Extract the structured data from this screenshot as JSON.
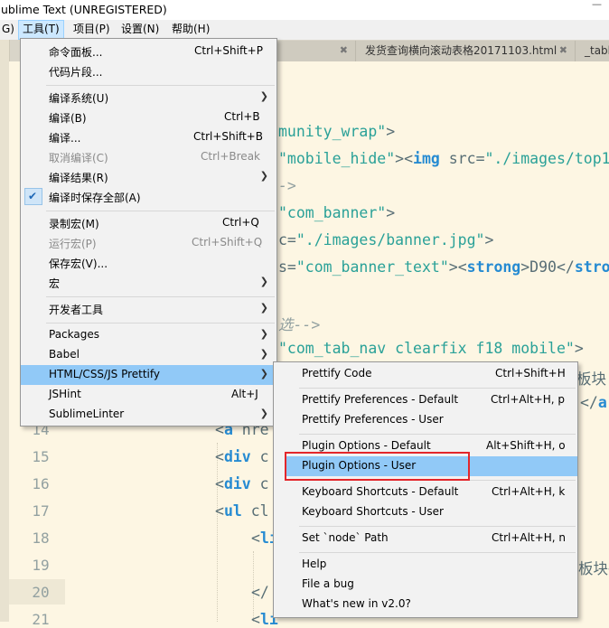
{
  "window": {
    "title": "ublime Text (UNREGISTERED)"
  },
  "menubar": [
    {
      "label": "G)",
      "active": false
    },
    {
      "label": "工具(T)",
      "active": true
    },
    {
      "label": "项目(P)",
      "active": false
    },
    {
      "label": "设置(N)",
      "active": false
    },
    {
      "label": "帮助(H)",
      "active": false
    }
  ],
  "tabs": [
    {
      "label": "",
      "close": "✖"
    },
    {
      "label": "发货查询横向滚动表格20171103.html",
      "close": "✖"
    },
    {
      "label": "_table",
      "close": ""
    }
  ],
  "gutter": {
    "lines": [
      "14",
      "15",
      "16",
      "17",
      "18",
      "19",
      "20",
      "21"
    ],
    "current_line": "20"
  },
  "code_lines": [
    {
      "tokens": [
        {
          "c": "str",
          "t": "munity_wrap\""
        },
        {
          "c": "pl",
          "t": ">"
        }
      ]
    },
    {
      "tokens": [
        {
          "c": "str",
          "t": "\"mobile_hide\""
        },
        {
          "c": "pl",
          "t": "><"
        },
        {
          "c": "tag",
          "t": "img"
        },
        {
          "c": "pl",
          "t": " src="
        },
        {
          "c": "str",
          "t": "\"./images/top1"
        }
      ]
    },
    {
      "tokens": [
        {
          "c": "cm",
          "t": "->"
        }
      ]
    },
    {
      "tokens": [
        {
          "c": "str",
          "t": "\"com_banner\""
        },
        {
          "c": "pl",
          "t": ">"
        }
      ]
    },
    {
      "tokens": [
        {
          "c": "pl",
          "t": "c="
        },
        {
          "c": "str",
          "t": "\"./images/banner.jpg\""
        },
        {
          "c": "pl",
          "t": ">"
        }
      ]
    },
    {
      "tokens": [
        {
          "c": "pl",
          "t": "s="
        },
        {
          "c": "str",
          "t": "\"com_banner_text\""
        },
        {
          "c": "pl",
          "t": "><"
        },
        {
          "c": "tag",
          "t": "strong"
        },
        {
          "c": "pl",
          "t": ">D90</"
        },
        {
          "c": "tag",
          "t": "stro"
        }
      ]
    },
    {
      "tokens": []
    },
    {
      "tokens": [
        {
          "c": "cm",
          "t": "选-->"
        }
      ]
    },
    {
      "tokens": [
        {
          "c": "str",
          "t": "\"com_tab_nav clearfix f18 mobile\""
        },
        {
          "c": "pl",
          "t": ">"
        }
      ]
    },
    {
      "tokens": [
        {
          "c": "pl",
          "t": "板块"
        }
      ]
    },
    {
      "tokens": [
        {
          "c": "pl",
          "t": "</"
        },
        {
          "c": "tag",
          "t": "a"
        }
      ]
    },
    {
      "tokens": [
        {
          "c": "pl",
          "t": "<"
        },
        {
          "c": "tag",
          "t": "a"
        },
        {
          "c": "pl",
          "t": " hre"
        }
      ]
    },
    {
      "tokens": [
        {
          "c": "pl",
          "t": "<"
        },
        {
          "c": "tag",
          "t": "div"
        },
        {
          "c": "pl",
          "t": " c"
        }
      ]
    },
    {
      "tokens": [
        {
          "c": "pl",
          "t": "<"
        },
        {
          "c": "tag",
          "t": "div"
        },
        {
          "c": "pl",
          "t": " c"
        }
      ]
    },
    {
      "tokens": [
        {
          "c": "pl",
          "t": "<"
        },
        {
          "c": "tag",
          "t": "ul"
        },
        {
          "c": "pl",
          "t": " cl"
        }
      ]
    },
    {
      "tokens": [
        {
          "c": "pl",
          "t": "<"
        },
        {
          "c": "tag",
          "t": "li"
        }
      ]
    },
    {
      "tokens": [
        {
          "c": "pl",
          "t": "板块<"
        }
      ]
    },
    {
      "tokens": [
        {
          "c": "pl",
          "t": "</"
        }
      ]
    },
    {
      "tokens": [
        {
          "c": "pl",
          "t": "<"
        },
        {
          "c": "tag",
          "t": "li"
        }
      ]
    }
  ],
  "tools_menu": {
    "items": [
      {
        "label": "命令面板...",
        "shortcut": "Ctrl+Shift+P"
      },
      {
        "label": "代码片段...",
        "shortcut": ""
      },
      {
        "label": "编译系统(U)",
        "shortcut": "",
        "submenu": true
      },
      {
        "label": "编译(B)",
        "shortcut": "Ctrl+B"
      },
      {
        "label": "编译...",
        "shortcut": "Ctrl+Shift+B"
      },
      {
        "label": "取消编译(C)",
        "shortcut": "Ctrl+Break",
        "disabled": true
      },
      {
        "label": "编译结果(R)",
        "shortcut": "",
        "submenu": true
      },
      {
        "label": "编译时保存全部(A)",
        "shortcut": "",
        "checked": true
      },
      {
        "label": "录制宏(M)",
        "shortcut": "Ctrl+Q"
      },
      {
        "label": "运行宏(P)",
        "shortcut": "Ctrl+Shift+Q",
        "disabled": true
      },
      {
        "label": "保存宏(V)...",
        "shortcut": ""
      },
      {
        "label": "宏",
        "shortcut": "",
        "submenu": true
      },
      {
        "label": "开发者工具",
        "shortcut": "",
        "submenu": true
      },
      {
        "label": "Packages",
        "shortcut": "",
        "submenu": true
      },
      {
        "label": "Babel",
        "shortcut": "",
        "submenu": true
      },
      {
        "label": "HTML/CSS/JS Prettify",
        "shortcut": "",
        "submenu": true,
        "highlighted": true
      },
      {
        "label": "JSHint",
        "shortcut": "Alt+J"
      },
      {
        "label": "SublimeLinter",
        "shortcut": "",
        "submenu": true
      }
    ]
  },
  "prettify_menu": {
    "items": [
      {
        "label": "Prettify Code",
        "shortcut": "Ctrl+Shift+H"
      },
      {
        "label": "Prettify Preferences - Default",
        "shortcut": "Ctrl+Alt+H, p"
      },
      {
        "label": "Prettify Preferences - User",
        "shortcut": ""
      },
      {
        "label": "Plugin Options - Default",
        "shortcut": "Alt+Shift+H, o"
      },
      {
        "label": "Plugin Options - User",
        "shortcut": "",
        "highlighted": true
      },
      {
        "label": "Keyboard Shortcuts - Default",
        "shortcut": "Ctrl+Alt+H, k"
      },
      {
        "label": "Keyboard Shortcuts - User",
        "shortcut": ""
      },
      {
        "label": "Set `node` Path",
        "shortcut": "Ctrl+Alt+H, n"
      },
      {
        "label": "Help",
        "shortcut": ""
      },
      {
        "label": "File a bug",
        "shortcut": ""
      },
      {
        "label": "What's new in v2.0?",
        "shortcut": ""
      }
    ]
  },
  "icons": {
    "submenu_arrow": "chevron-right-icon",
    "check": "check-icon"
  },
  "colors": {
    "editor_bg": "#fdf6e3",
    "menu_highlight": "#91c9f7",
    "annotation_box": "#e3262b",
    "string": "#2aa198",
    "tag": "#268bd2"
  }
}
